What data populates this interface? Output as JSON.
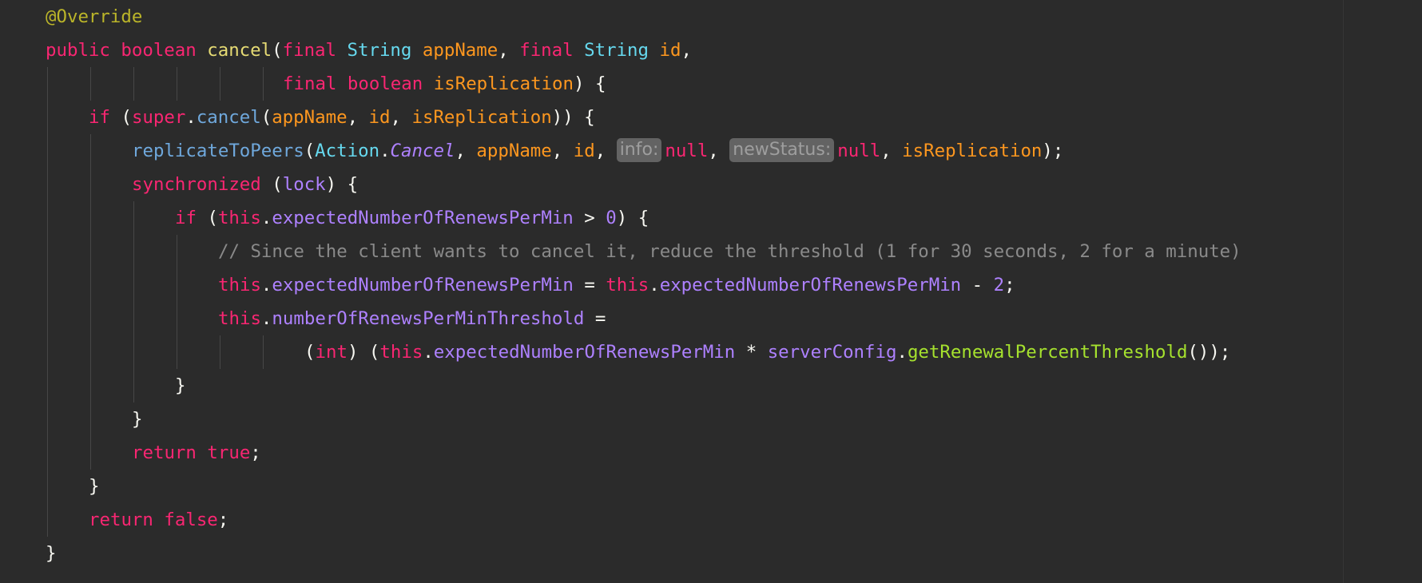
{
  "colors": {
    "background": "#2b2b2b",
    "keyword": "#f92672",
    "annotation": "#bbb529",
    "type": "#66d9ef",
    "parameter": "#fd971f",
    "field": "#ae81ff",
    "comment": "#8a8a8a",
    "method_call": "#a6e22e"
  },
  "code": {
    "lines": [
      {
        "indent": 0,
        "tokens": [
          {
            "t": "@Override",
            "c": "ann"
          }
        ]
      },
      {
        "indent": 0,
        "tokens": [
          {
            "t": "public",
            "c": "kw"
          },
          {
            "t": " ",
            "c": "pl"
          },
          {
            "t": "boolean",
            "c": "kw"
          },
          {
            "t": " ",
            "c": "pl"
          },
          {
            "t": "cancel",
            "c": "fn"
          },
          {
            "t": "(",
            "c": "pl"
          },
          {
            "t": "final",
            "c": "kw"
          },
          {
            "t": " ",
            "c": "pl"
          },
          {
            "t": "String",
            "c": "ty"
          },
          {
            "t": " ",
            "c": "pl"
          },
          {
            "t": "appName",
            "c": "prm"
          },
          {
            "t": ", ",
            "c": "pl"
          },
          {
            "t": "final",
            "c": "kw"
          },
          {
            "t": " ",
            "c": "pl"
          },
          {
            "t": "String",
            "c": "ty"
          },
          {
            "t": " ",
            "c": "pl"
          },
          {
            "t": "id",
            "c": "prm"
          },
          {
            "t": ",",
            "c": "pl"
          }
        ]
      },
      {
        "indent": 22,
        "tokens": [
          {
            "t": "final",
            "c": "kw"
          },
          {
            "t": " ",
            "c": "pl"
          },
          {
            "t": "boolean",
            "c": "kw"
          },
          {
            "t": " ",
            "c": "pl"
          },
          {
            "t": "isReplication",
            "c": "prm"
          },
          {
            "t": ") {",
            "c": "pl"
          }
        ]
      },
      {
        "indent": 4,
        "tokens": [
          {
            "t": "if",
            "c": "kw"
          },
          {
            "t": " (",
            "c": "pl"
          },
          {
            "t": "super",
            "c": "kw"
          },
          {
            "t": ".",
            "c": "pl"
          },
          {
            "t": "cancel",
            "c": "mth"
          },
          {
            "t": "(",
            "c": "pl"
          },
          {
            "t": "appName",
            "c": "prm"
          },
          {
            "t": ", ",
            "c": "pl"
          },
          {
            "t": "id",
            "c": "prm"
          },
          {
            "t": ", ",
            "c": "pl"
          },
          {
            "t": "isReplication",
            "c": "prm"
          },
          {
            "t": ")) {",
            "c": "pl"
          }
        ]
      },
      {
        "indent": 8,
        "tokens": [
          {
            "t": "replicateToPeers",
            "c": "mth"
          },
          {
            "t": "(",
            "c": "pl"
          },
          {
            "t": "Action",
            "c": "ty"
          },
          {
            "t": ".",
            "c": "pl"
          },
          {
            "t": "Cancel",
            "c": "ital"
          },
          {
            "t": ", ",
            "c": "pl"
          },
          {
            "t": "appName",
            "c": "prm"
          },
          {
            "t": ", ",
            "c": "pl"
          },
          {
            "t": "id",
            "c": "prm"
          },
          {
            "t": ", ",
            "c": "pl"
          },
          {
            "t": "info:",
            "c": "hint"
          },
          {
            "t": "null",
            "c": "kw"
          },
          {
            "t": ", ",
            "c": "pl"
          },
          {
            "t": "newStatus:",
            "c": "hint"
          },
          {
            "t": "null",
            "c": "kw"
          },
          {
            "t": ", ",
            "c": "pl"
          },
          {
            "t": "isReplication",
            "c": "prm"
          },
          {
            "t": ");",
            "c": "pl"
          }
        ]
      },
      {
        "indent": 8,
        "tokens": [
          {
            "t": "synchronized",
            "c": "kw"
          },
          {
            "t": " (",
            "c": "pl"
          },
          {
            "t": "lock",
            "c": "fld"
          },
          {
            "t": ") {",
            "c": "pl"
          }
        ]
      },
      {
        "indent": 12,
        "tokens": [
          {
            "t": "if",
            "c": "kw"
          },
          {
            "t": " (",
            "c": "pl"
          },
          {
            "t": "this",
            "c": "kw"
          },
          {
            "t": ".",
            "c": "pl"
          },
          {
            "t": "expectedNumberOfRenewsPerMin",
            "c": "fld"
          },
          {
            "t": " > ",
            "c": "pl"
          },
          {
            "t": "0",
            "c": "num"
          },
          {
            "t": ") {",
            "c": "pl"
          }
        ]
      },
      {
        "indent": 16,
        "tokens": [
          {
            "t": "// Since the client wants to cancel it, reduce the threshold (1 for 30 seconds, 2 for a minute)",
            "c": "cmt"
          }
        ]
      },
      {
        "indent": 16,
        "tokens": [
          {
            "t": "this",
            "c": "kw"
          },
          {
            "t": ".",
            "c": "pl"
          },
          {
            "t": "expectedNumberOfRenewsPerMin",
            "c": "fld"
          },
          {
            "t": " = ",
            "c": "pl"
          },
          {
            "t": "this",
            "c": "kw"
          },
          {
            "t": ".",
            "c": "pl"
          },
          {
            "t": "expectedNumberOfRenewsPerMin",
            "c": "fld"
          },
          {
            "t": " - ",
            "c": "pl"
          },
          {
            "t": "2",
            "c": "num"
          },
          {
            "t": ";",
            "c": "pl"
          }
        ]
      },
      {
        "indent": 16,
        "tokens": [
          {
            "t": "this",
            "c": "kw"
          },
          {
            "t": ".",
            "c": "pl"
          },
          {
            "t": "numberOfRenewsPerMinThreshold",
            "c": "fld"
          },
          {
            "t": " =",
            "c": "pl"
          }
        ]
      },
      {
        "indent": 24,
        "tokens": [
          {
            "t": "(",
            "c": "pl"
          },
          {
            "t": "int",
            "c": "kw"
          },
          {
            "t": ") (",
            "c": "pl"
          },
          {
            "t": "this",
            "c": "kw"
          },
          {
            "t": ".",
            "c": "pl"
          },
          {
            "t": "expectedNumberOfRenewsPerMin",
            "c": "fld"
          },
          {
            "t": " * ",
            "c": "pl"
          },
          {
            "t": "serverConfig",
            "c": "fld"
          },
          {
            "t": ".",
            "c": "pl"
          },
          {
            "t": "getRenewalPercentThreshold",
            "c": "call"
          },
          {
            "t": "());",
            "c": "pl"
          }
        ]
      },
      {
        "indent": 12,
        "tokens": [
          {
            "t": "}",
            "c": "pl"
          }
        ]
      },
      {
        "indent": 8,
        "tokens": [
          {
            "t": "}",
            "c": "pl"
          }
        ]
      },
      {
        "indent": 8,
        "tokens": [
          {
            "t": "return",
            "c": "kw"
          },
          {
            "t": " ",
            "c": "pl"
          },
          {
            "t": "true",
            "c": "kw"
          },
          {
            "t": ";",
            "c": "pl"
          }
        ]
      },
      {
        "indent": 4,
        "tokens": [
          {
            "t": "}",
            "c": "pl"
          }
        ]
      },
      {
        "indent": 4,
        "tokens": [
          {
            "t": "return",
            "c": "kw"
          },
          {
            "t": " ",
            "c": "pl"
          },
          {
            "t": "false",
            "c": "kw"
          },
          {
            "t": ";",
            "c": "pl"
          }
        ]
      },
      {
        "indent": 0,
        "tokens": [
          {
            "t": "}",
            "c": "pl"
          }
        ]
      }
    ]
  }
}
